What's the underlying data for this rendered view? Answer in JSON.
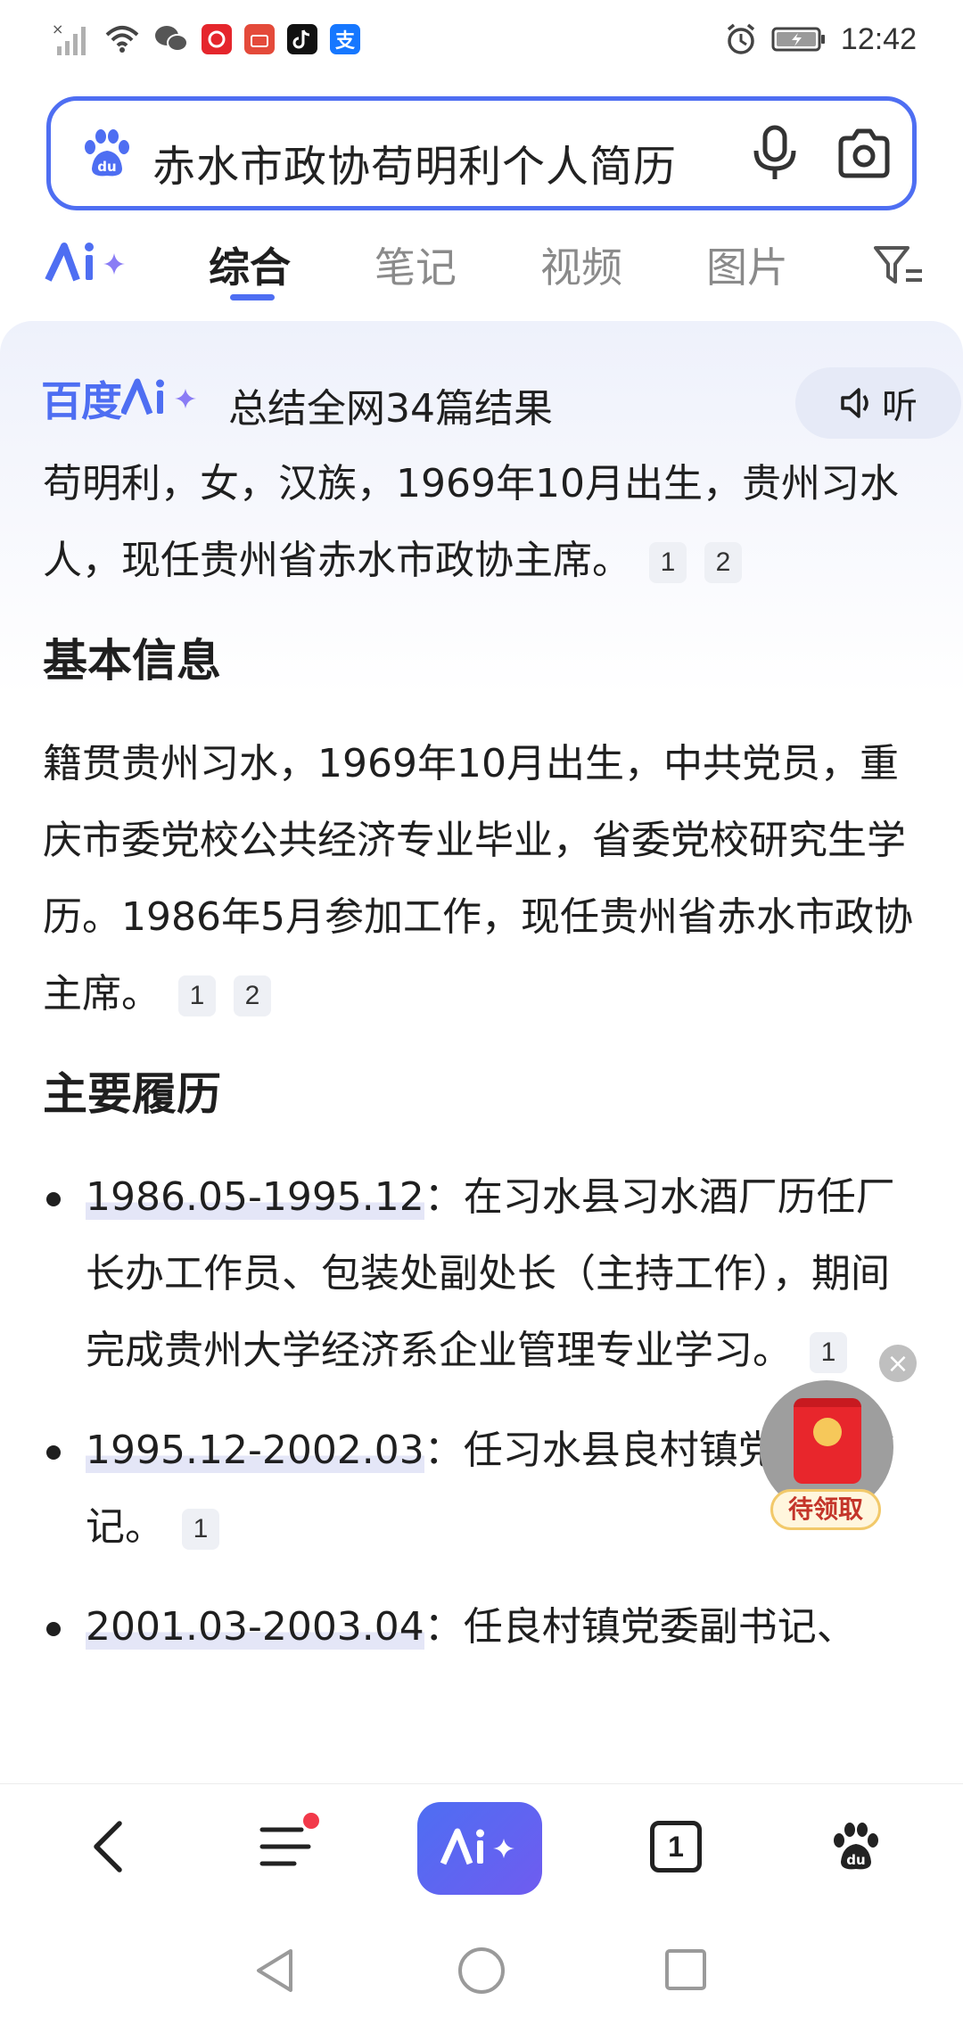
{
  "status_bar": {
    "time": "12:42",
    "app_icons": [
      "baidu-news-icon",
      "vmall-icon",
      "tiktok-icon",
      "alipay-icon"
    ],
    "alipay_char": "支"
  },
  "search": {
    "query": "赤水市政协苟明利个人简历"
  },
  "tabs": {
    "items": [
      {
        "label": "综合",
        "active": true
      },
      {
        "label": "笔记",
        "active": false
      },
      {
        "label": "视频",
        "active": false
      },
      {
        "label": "图片",
        "active": false
      }
    ]
  },
  "ai_card": {
    "logo_text": "百度",
    "summary": "总结全网34篇结果",
    "listen_label": "听",
    "intro": "苟明利，女，汉族，1969年10月出生，贵州习水人，现任贵州省赤水市政协主席。",
    "intro_refs": [
      "1",
      "2"
    ],
    "section1": {
      "heading": "基本信息",
      "text": "籍贯贵州习水，1969年10月出生，中共党员，重庆市委党校公共经济专业毕业，省委党校研究生学历。1986年5月参加工作，现任贵州省赤水市政协主席。",
      "refs": [
        "1",
        "2"
      ]
    },
    "section2": {
      "heading": "主要履历",
      "items": [
        {
          "date": "1986.05-1995.12",
          "text": "：在习水县习水酒厂历任厂长办工作员、包装处副处长（主持工作），期间完成贵州大学经济系企业管理专业学习。",
          "ref": "1"
        },
        {
          "date": "1995.12-2002.03",
          "text": "：任习水县良村镇党委副书记。",
          "ref": "1"
        },
        {
          "date": "2001.03-2003.04",
          "text": "：任良村镇党委副书记、",
          "ref": ""
        }
      ]
    }
  },
  "floating": {
    "label": "待领取"
  },
  "bottom_nav": {
    "tab_count": "1"
  },
  "colors": {
    "accent": "#4e6ef2",
    "badge_red": "#f2394a"
  }
}
